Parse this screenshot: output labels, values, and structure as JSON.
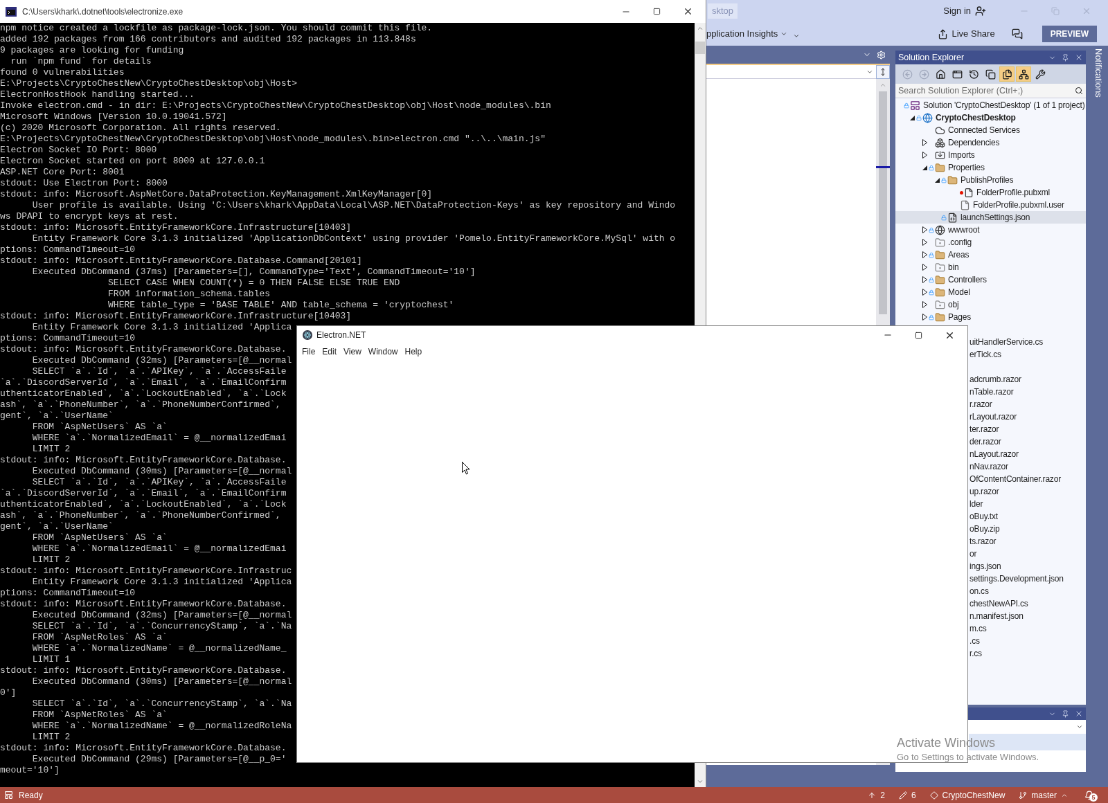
{
  "console": {
    "title": "C:\\Users\\khark\\.dotnet\\tools\\electronize.exe",
    "lines": [
      "npm notice created a lockfile as package-lock.json. You should commit this file.",
      "added 192 packages from 166 contributors and audited 192 packages in 113.848s",
      "9 packages are looking for funding",
      "  run `npm fund` for details",
      "found 0 vulnerabilities",
      "E:\\Projects\\CryptoChestNew\\CryptoChestDesktop\\obj\\Host>",
      "ElectronHostHook handling started...",
      "Invoke electron.cmd - in dir: E:\\Projects\\CryptoChestNew\\CryptoChestDesktop\\obj\\Host\\node_modules\\.bin",
      "Microsoft Windows [Version 10.0.19041.572]",
      "(c) 2020 Microsoft Corporation. All rights reserved.",
      "E:\\Projects\\CryptoChestNew\\CryptoChestDesktop\\obj\\Host\\node_modules\\.bin>electron.cmd \"..\\..\\main.js\"",
      "Electron Socket IO Port: 8000",
      "Electron Socket started on port 8000 at 127.0.0.1",
      "ASP.NET Core Port: 8001",
      "stdout: Use Electron Port: 8000",
      "stdout: info: Microsoft.AspNetCore.DataProtection.KeyManagement.XmlKeyManager[0]",
      "      User profile is available. Using 'C:\\Users\\khark\\AppData\\Local\\ASP.NET\\DataProtection-Keys' as key repository and Windo",
      "ws DPAPI to encrypt keys at rest.",
      "stdout: info: Microsoft.EntityFrameworkCore.Infrastructure[10403]",
      "      Entity Framework Core 3.1.3 initialized 'ApplicationDbContext' using provider 'Pomelo.EntityFrameworkCore.MySql' with o",
      "ptions: CommandTimeout=10",
      "stdout: info: Microsoft.EntityFrameworkCore.Database.Command[20101]",
      "      Executed DbCommand (37ms) [Parameters=[], CommandType='Text', CommandTimeout='10']",
      "                    SELECT CASE WHEN COUNT(*) = 0 THEN FALSE ELSE TRUE END",
      "                    FROM information_schema.tables",
      "                    WHERE table_type = 'BASE TABLE' AND table_schema = 'cryptochest'",
      "stdout: info: Microsoft.EntityFrameworkCore.Infrastructure[10403]",
      "      Entity Framework Core 3.1.3 initialized 'Applica",
      "ptions: CommandTimeout=10",
      "stdout: info: Microsoft.EntityFrameworkCore.Database.",
      "      Executed DbCommand (32ms) [Parameters=[@__normal",
      "      SELECT `a`.`Id`, `a`.`APIKey`, `a`.`AccessFaile",
      "`a`.`DiscordServerId`, `a`.`Email`, `a`.`EmailConfirm",
      "uthenticatorEnabled`, `a`.`LockoutEnabled`, `a`.`Lock",
      "ash`, `a`.`PhoneNumber`, `a`.`PhoneNumberConfirmed`,",
      "gent`, `a`.`UserName`",
      "      FROM `AspNetUsers` AS `a`",
      "      WHERE `a`.`NormalizedEmail` = @__normalizedEmai",
      "      LIMIT 2",
      "stdout: info: Microsoft.EntityFrameworkCore.Database.",
      "      Executed DbCommand (30ms) [Parameters=[@__normal",
      "      SELECT `a`.`Id`, `a`.`APIKey`, `a`.`AccessFaile",
      "`a`.`DiscordServerId`, `a`.`Email`, `a`.`EmailConfirm",
      "uthenticatorEnabled`, `a`.`LockoutEnabled`, `a`.`Lock",
      "ash`, `a`.`PhoneNumber`, `a`.`PhoneNumberConfirmed`,",
      "gent`, `a`.`UserName`",
      "      FROM `AspNetUsers` AS `a`",
      "      WHERE `a`.`NormalizedEmail` = @__normalizedEmai",
      "      LIMIT 2",
      "stdout: info: Microsoft.EntityFrameworkCore.Infrastruc",
      "      Entity Framework Core 3.1.3 initialized 'Applica",
      "ptions: CommandTimeout=10",
      "stdout: info: Microsoft.EntityFrameworkCore.Database.",
      "      Executed DbCommand (32ms) [Parameters=[@__normal",
      "      SELECT `a`.`Id`, `a`.`ConcurrencyStamp`, `a`.`Na",
      "      FROM `AspNetRoles` AS `a`",
      "      WHERE `a`.`NormalizedName` = @__normalizedName_",
      "      LIMIT 1",
      "stdout: info: Microsoft.EntityFrameworkCore.Database.",
      "      Executed DbCommand (30ms) [Parameters=[@__normal",
      "0']",
      "      SELECT `a`.`Id`, `a`.`ConcurrencyStamp`, `a`.`Na",
      "      FROM `AspNetRoles` AS `a`",
      "      WHERE `a`.`NormalizedName` = @__normalizedRoleNa",
      "      LIMIT 2",
      "stdout: info: Microsoft.EntityFrameworkCore.Database.",
      "      Executed DbCommand (29ms) [Parameters=[@__p_0='",
      "meout='10']"
    ]
  },
  "vs": {
    "tab": "sktop",
    "sign_in": "Sign in",
    "toolbar_item": "pplication Insights",
    "live_share": "Live Share",
    "preview": "PREVIEW",
    "notifications": "Notifications"
  },
  "solution_explorer": {
    "title": "Solution Explorer",
    "search": {
      "placeholder": "Search Solution Explorer (Ctrl+;)"
    },
    "toolbar": [
      {
        "kind": "back",
        "disabled": true,
        "on": false
      },
      {
        "kind": "forward",
        "disabled": true,
        "on": false
      },
      {
        "kind": "home",
        "disabled": false,
        "on": false
      },
      {
        "kind": "switch-views",
        "disabled": false,
        "on": false
      },
      {
        "kind": "history",
        "disabled": false,
        "on": false
      },
      {
        "kind": "collapse",
        "disabled": false,
        "on": false
      },
      {
        "kind": "show-all",
        "disabled": false,
        "on": true
      },
      {
        "kind": "sync",
        "disabled": false,
        "on": true
      },
      {
        "kind": "properties",
        "disabled": false,
        "on": false
      }
    ],
    "tree": [
      {
        "label": "Solution 'CryptoChestDesktop' (1 of 1 project)",
        "kind": "solution",
        "locked": true,
        "selected": false,
        "children": [
          {
            "label": "CryptoChestDesktop",
            "kind": "project",
            "locked": true,
            "expanded": true,
            "selected": false,
            "children": [
              {
                "label": "Connected Services",
                "kind": "connected-services",
                "locked": false,
                "selected": false
              },
              {
                "label": "Dependencies",
                "kind": "dependencies",
                "locked": false,
                "expanded": false,
                "selected": false
              },
              {
                "label": "Imports",
                "kind": "imports",
                "locked": false,
                "expanded": false,
                "selected": false
              },
              {
                "label": "Properties",
                "kind": "properties",
                "locked": true,
                "expanded": true,
                "selected": false,
                "children": [
                  {
                    "label": "PublishProfiles",
                    "kind": "folder",
                    "locked": true,
                    "expanded": true,
                    "selected": false,
                    "children": [
                      {
                        "label": "FolderProfile.pubxml",
                        "kind": "removed-file",
                        "locked": false,
                        "selected": false
                      },
                      {
                        "label": "FolderProfile.pubxml.user",
                        "kind": "file",
                        "locked": false,
                        "selected": false
                      }
                    ]
                  },
                  {
                    "label": "launchSettings.json",
                    "kind": "json-file",
                    "locked": true,
                    "selected": true
                  }
                ]
              },
              {
                "label": "wwwroot",
                "kind": "web-folder",
                "locked": true,
                "expanded": false,
                "selected": false
              },
              {
                "label": ".config",
                "kind": "hidden-folder",
                "locked": false,
                "expanded": false,
                "selected": false
              },
              {
                "label": "Areas",
                "kind": "folder",
                "locked": true,
                "expanded": false,
                "selected": false
              },
              {
                "label": "bin",
                "kind": "hidden-folder",
                "locked": false,
                "expanded": false,
                "selected": false
              },
              {
                "label": "Controllers",
                "kind": "folder",
                "locked": true,
                "expanded": false,
                "selected": false
              },
              {
                "label": "Model",
                "kind": "folder",
                "locked": true,
                "expanded": false,
                "selected": false
              },
              {
                "label": "obj",
                "kind": "hidden-folder",
                "locked": false,
                "expanded": false,
                "selected": false
              },
              {
                "label": "Pages",
                "kind": "folder",
                "locked": true,
                "expanded": false,
                "selected": false
              }
            ]
          }
        ]
      }
    ],
    "covered_rows": [
      [
        "uitHandlerService.cs",
        "erTick.cs"
      ],
      [
        "adcrumb.razor",
        "nTable.razor",
        "r.razor",
        "rLayout.razor",
        "ter.razor",
        "der.razor",
        "nLayout.razor",
        "nNav.razor",
        "OfContentContainer.razor",
        "up.razor",
        "lder",
        "oBuy.txt",
        "oBuy.zip",
        "ts.razor",
        "or",
        "ings.json",
        "settings.Development.json",
        "on.cs",
        "chestNewAPI.cs",
        "n.manifest.json",
        "m.cs",
        ".cs",
        "r.cs"
      ]
    ]
  },
  "electron": {
    "title": "Electron.NET",
    "menu": [
      "File",
      "Edit",
      "View",
      "Window",
      "Help"
    ]
  },
  "activation": {
    "title": "Activate Windows",
    "hint": "Go to Settings to activate Windows."
  },
  "status_bar": {
    "text": "Ready",
    "items": [
      {
        "kind": "push",
        "text": "2"
      },
      {
        "kind": "edits",
        "text": "6"
      },
      {
        "kind": "repo",
        "text": "CryptoChestNew"
      },
      {
        "kind": "branch",
        "text": "master"
      }
    ],
    "badge": "5"
  }
}
